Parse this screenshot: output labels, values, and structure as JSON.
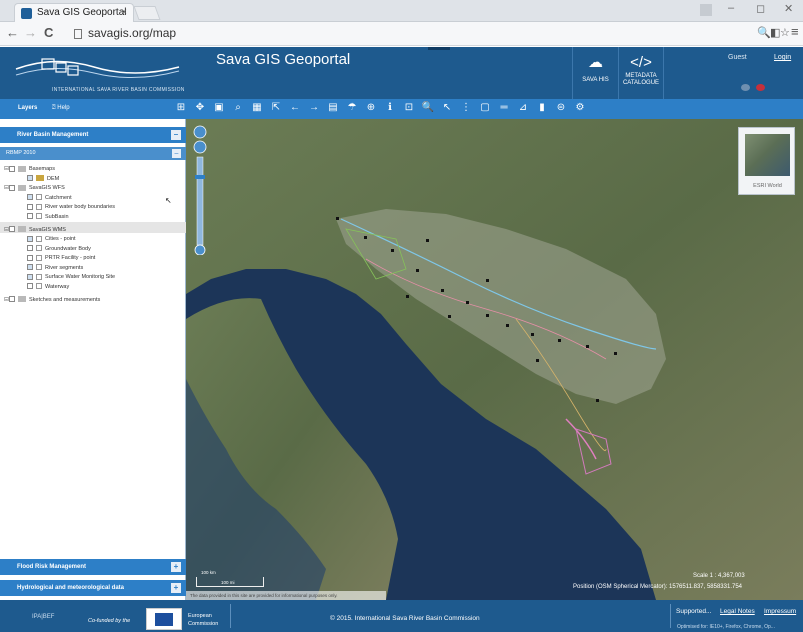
{
  "browser": {
    "tab_title": "Sava GIS Geoportal",
    "tab_close": "×",
    "url": "savagis.org/map",
    "back": "←",
    "forward": "→",
    "reload": "C",
    "minimize": "–",
    "maximize": "◻",
    "close": "✕",
    "zoom_icon": "🔍",
    "ext_icon": "◧",
    "star": "☆",
    "menu": "≡"
  },
  "header": {
    "org_name": "INTERNATIONAL SAVA RIVER BASIN COMMISSION",
    "title": "Sava GIS Geoportal",
    "sava_his": "SAVA HIS",
    "metadata_line1": "METADATA",
    "metadata_line2": "CATALOGUE",
    "guest": "Guest",
    "login": "Login"
  },
  "toolbar": {
    "layers": "Layers",
    "help": "Help",
    "tools": [
      "⊞",
      "✥",
      "▣",
      "⌕",
      "▦",
      "⇱",
      "←",
      "→",
      "▤",
      "☂",
      "⊕",
      "ℹ",
      "⊡",
      "🔍",
      "↖",
      "⋮",
      "▢",
      "═",
      "⊿",
      "▮",
      "⊜",
      "⚙"
    ]
  },
  "sidebar": {
    "river_basin": "River Basin Management",
    "rbmp": "RBMP 2010",
    "flood": "Flood Risk Management",
    "hydro": "Hydrological and meteorological data",
    "tree": [
      {
        "label": "Basemaps",
        "indent": 0,
        "kind": "folder"
      },
      {
        "label": "DEM",
        "indent": 1,
        "kind": "raster"
      },
      {
        "label": "SavaGIS WFS",
        "indent": 0,
        "kind": "folder"
      },
      {
        "label": "Catchment",
        "indent": 1,
        "kind": "layer"
      },
      {
        "label": "River water body boundaries",
        "indent": 1,
        "kind": "layer"
      },
      {
        "label": "SubBasin",
        "indent": 1,
        "kind": "layer"
      },
      {
        "label": "SavaGIS WMS",
        "indent": 0,
        "kind": "folder"
      },
      {
        "label": "Cities - point",
        "indent": 1,
        "kind": "layer"
      },
      {
        "label": "Groundwater Body",
        "indent": 1,
        "kind": "layer"
      },
      {
        "label": "PRTR Facility - point",
        "indent": 1,
        "kind": "layer"
      },
      {
        "label": "River segments",
        "indent": 1,
        "kind": "layer"
      },
      {
        "label": "Surface Water Monitorig Site",
        "indent": 1,
        "kind": "layer"
      },
      {
        "label": "Waterway",
        "indent": 1,
        "kind": "layer"
      },
      {
        "label": "Sketches and measurements",
        "indent": 0,
        "kind": "folder"
      }
    ]
  },
  "map": {
    "esri_label": "ESRI World",
    "scale": "Scale 1 : 4,367,003",
    "position": "Position (OSM Spherical Mercator): 1576511.837, 5858331.754",
    "notice": "The data provided in this site are provided for informational purposes only.",
    "scale_km": "100 km",
    "scale_mi": "100 mi"
  },
  "footer": {
    "eu_left": "IPA|BEF",
    "cofunded": "Co-funded by the",
    "eu_line1": "European",
    "eu_line2": "Commission",
    "copyright": "© 2015. International Sava River Basin Commission",
    "supported": "Supported...",
    "legal": "Legal Notes",
    "impressum": "Impressum",
    "optimised": "Optimised for: IE10+, Firefox, Chrome, Op..."
  },
  "colors": {
    "header": "#1e5a8e",
    "toolbar": "#2d7fc7",
    "sea": "#1c3558"
  }
}
